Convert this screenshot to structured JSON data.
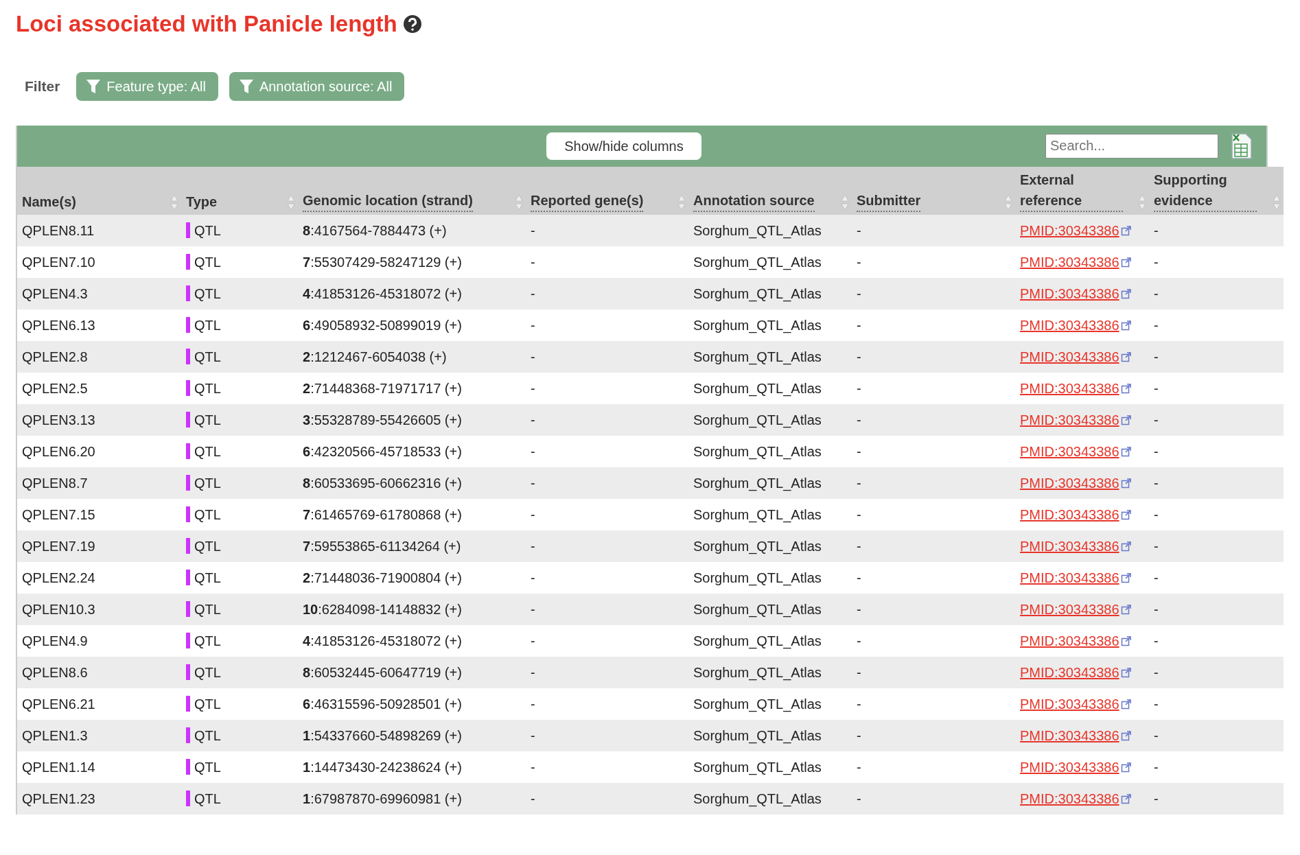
{
  "title": "Loci associated with Panicle length",
  "filter": {
    "label": "Filter",
    "buttons": [
      "Feature type: All",
      "Annotation source: All"
    ]
  },
  "toolbar": {
    "columns_button": "Show/hide columns",
    "search": {
      "placeholder": "Search..."
    }
  },
  "table": {
    "columns": [
      {
        "label": "Name(s)",
        "tooltip": false
      },
      {
        "label": "Type",
        "tooltip": false
      },
      {
        "label": "Genomic location (strand)",
        "tooltip": true
      },
      {
        "label": "Reported gene(s)",
        "tooltip": true
      },
      {
        "label": "Annotation source",
        "tooltip": true
      },
      {
        "label": "Submitter",
        "tooltip": true
      },
      {
        "label": "External reference",
        "tooltip": true
      },
      {
        "label": "Supporting evidence",
        "tooltip": true
      }
    ],
    "rows": [
      {
        "name": "QPLEN8.11",
        "type": "QTL",
        "color": "#cc33ff",
        "location": "**8**:4167564-7884473 (+)",
        "genes": "-",
        "source": "Sorghum_QTL_Atlas",
        "submitter": "-",
        "reference": "PMID:30343386",
        "evidence": "-"
      },
      {
        "name": "QPLEN7.10",
        "type": "QTL",
        "color": "#cc33ff",
        "location": "**7**:55307429-58247129 (+)",
        "genes": "-",
        "source": "Sorghum_QTL_Atlas",
        "submitter": "-",
        "reference": "PMID:30343386",
        "evidence": "-"
      },
      {
        "name": "QPLEN4.3",
        "type": "QTL",
        "color": "#cc33ff",
        "location": "**4**:41853126-45318072 (+)",
        "genes": "-",
        "source": "Sorghum_QTL_Atlas",
        "submitter": "-",
        "reference": "PMID:30343386",
        "evidence": "-"
      },
      {
        "name": "QPLEN6.13",
        "type": "QTL",
        "color": "#cc33ff",
        "location": "**6**:49058932-50899019 (+)",
        "genes": "-",
        "source": "Sorghum_QTL_Atlas",
        "submitter": "-",
        "reference": "PMID:30343386",
        "evidence": "-"
      },
      {
        "name": "QPLEN2.8",
        "type": "QTL",
        "color": "#cc33ff",
        "location": "**2**:1212467-6054038 (+)",
        "genes": "-",
        "source": "Sorghum_QTL_Atlas",
        "submitter": "-",
        "reference": "PMID:30343386",
        "evidence": "-"
      },
      {
        "name": "QPLEN2.5",
        "type": "QTL",
        "color": "#cc33ff",
        "location": "**2**:71448368-71971717 (+)",
        "genes": "-",
        "source": "Sorghum_QTL_Atlas",
        "submitter": "-",
        "reference": "PMID:30343386",
        "evidence": "-"
      },
      {
        "name": "QPLEN3.13",
        "type": "QTL",
        "color": "#cc33ff",
        "location": "**3**:55328789-55426605 (+)",
        "genes": "-",
        "source": "Sorghum_QTL_Atlas",
        "submitter": "-",
        "reference": "PMID:30343386",
        "evidence": "-"
      },
      {
        "name": "QPLEN6.20",
        "type": "QTL",
        "color": "#cc33ff",
        "location": "**6**:42320566-45718533 (+)",
        "genes": "-",
        "source": "Sorghum_QTL_Atlas",
        "submitter": "-",
        "reference": "PMID:30343386",
        "evidence": "-"
      },
      {
        "name": "QPLEN8.7",
        "type": "QTL",
        "color": "#cc33ff",
        "location": "**8**:60533695-60662316 (+)",
        "genes": "-",
        "source": "Sorghum_QTL_Atlas",
        "submitter": "-",
        "reference": "PMID:30343386",
        "evidence": "-"
      },
      {
        "name": "QPLEN7.15",
        "type": "QTL",
        "color": "#cc33ff",
        "location": "**7**:61465769-61780868 (+)",
        "genes": "-",
        "source": "Sorghum_QTL_Atlas",
        "submitter": "-",
        "reference": "PMID:30343386",
        "evidence": "-"
      },
      {
        "name": "QPLEN7.19",
        "type": "QTL",
        "color": "#cc33ff",
        "location": "**7**:59553865-61134264 (+)",
        "genes": "-",
        "source": "Sorghum_QTL_Atlas",
        "submitter": "-",
        "reference": "PMID:30343386",
        "evidence": "-"
      },
      {
        "name": "QPLEN2.24",
        "type": "QTL",
        "color": "#cc33ff",
        "location": "**2**:71448036-71900804 (+)",
        "genes": "-",
        "source": "Sorghum_QTL_Atlas",
        "submitter": "-",
        "reference": "PMID:30343386",
        "evidence": "-"
      },
      {
        "name": "QPLEN10.3",
        "type": "QTL",
        "color": "#cc33ff",
        "location": "**10**:6284098-14148832 (+)",
        "genes": "-",
        "source": "Sorghum_QTL_Atlas",
        "submitter": "-",
        "reference": "PMID:30343386",
        "evidence": "-"
      },
      {
        "name": "QPLEN4.9",
        "type": "QTL",
        "color": "#cc33ff",
        "location": "**4**:41853126-45318072 (+)",
        "genes": "-",
        "source": "Sorghum_QTL_Atlas",
        "submitter": "-",
        "reference": "PMID:30343386",
        "evidence": "-"
      },
      {
        "name": "QPLEN8.6",
        "type": "QTL",
        "color": "#cc33ff",
        "location": "**8**:60532445-60647719 (+)",
        "genes": "-",
        "source": "Sorghum_QTL_Atlas",
        "submitter": "-",
        "reference": "PMID:30343386",
        "evidence": "-"
      },
      {
        "name": "QPLEN6.21",
        "type": "QTL",
        "color": "#cc33ff",
        "location": "**6**:46315596-50928501 (+)",
        "genes": "-",
        "source": "Sorghum_QTL_Atlas",
        "submitter": "-",
        "reference": "PMID:30343386",
        "evidence": "-"
      },
      {
        "name": "QPLEN1.3",
        "type": "QTL",
        "color": "#cc33ff",
        "location": "**1**:54337660-54898269 (+)",
        "genes": "-",
        "source": "Sorghum_QTL_Atlas",
        "submitter": "-",
        "reference": "PMID:30343386",
        "evidence": "-"
      },
      {
        "name": "QPLEN1.14",
        "type": "QTL",
        "color": "#cc33ff",
        "location": "**1**:14473430-24238624 (+)",
        "genes": "-",
        "source": "Sorghum_QTL_Atlas",
        "submitter": "-",
        "reference": "PMID:30343386",
        "evidence": "-"
      },
      {
        "name": "QPLEN1.23",
        "type": "QTL",
        "color": "#cc33ff",
        "location": "**1**:67987870-69960981 (+)",
        "genes": "-",
        "source": "Sorghum_QTL_Atlas",
        "submitter": "-",
        "reference": "PMID:30343386",
        "evidence": "-"
      }
    ]
  }
}
